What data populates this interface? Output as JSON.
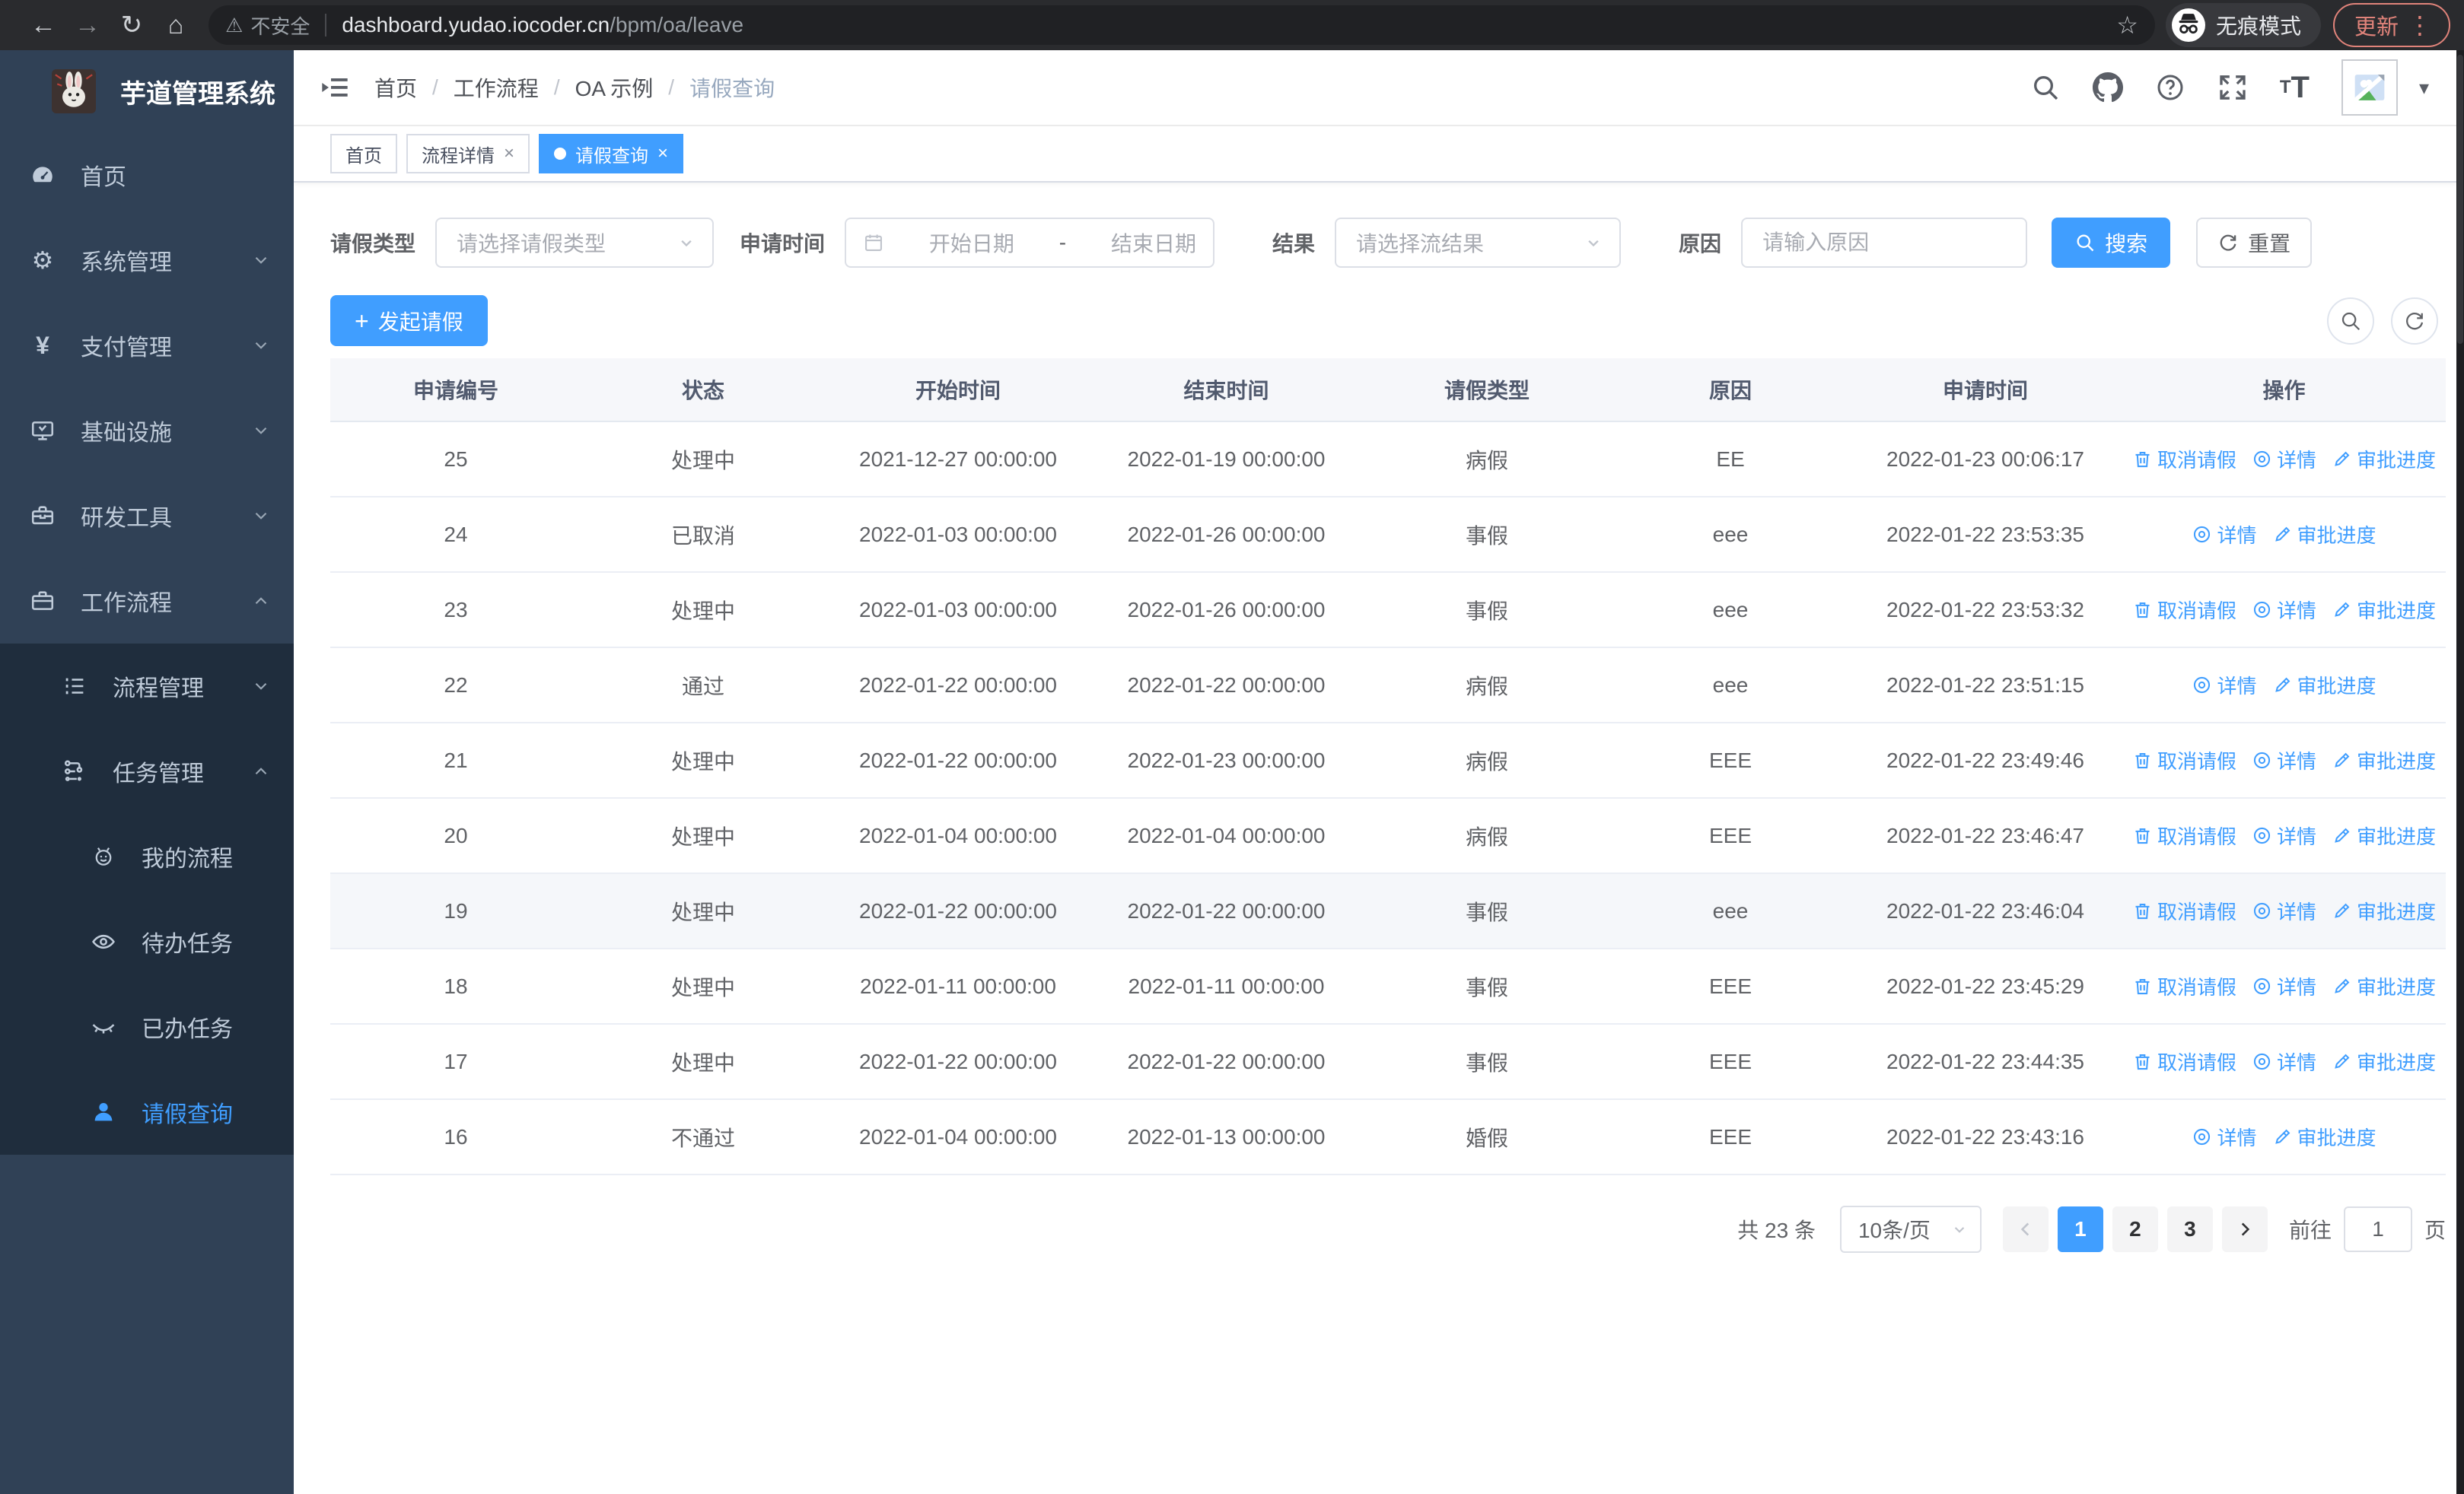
{
  "browser": {
    "security_label": "不安全",
    "url_host": "dashboard.yudao.iocoder.cn",
    "url_path": "/bpm/oa/leave",
    "incognito_label": "无痕模式",
    "update_label": "更新"
  },
  "sidebar": {
    "app_title": "芋道管理系统",
    "menu": [
      {
        "label": "首页"
      },
      {
        "label": "系统管理"
      },
      {
        "label": "支付管理"
      },
      {
        "label": "基础设施"
      },
      {
        "label": "研发工具"
      },
      {
        "label": "工作流程"
      }
    ],
    "submenu": [
      {
        "label": "流程管理"
      },
      {
        "label": "任务管理"
      },
      {
        "label": "我的流程"
      },
      {
        "label": "待办任务"
      },
      {
        "label": "已办任务"
      },
      {
        "label": "请假查询"
      }
    ]
  },
  "navbar": {
    "breadcrumb": [
      "首页",
      "工作流程",
      "OA 示例",
      "请假查询"
    ],
    "breadcrumb_separator": "/"
  },
  "tabs": [
    {
      "label": "首页",
      "closable": false,
      "active": false
    },
    {
      "label": "流程详情",
      "closable": true,
      "active": false
    },
    {
      "label": "请假查询",
      "closable": true,
      "active": true
    }
  ],
  "filters": {
    "leave_type_label": "请假类型",
    "leave_type_placeholder": "请选择请假类型",
    "apply_time_label": "申请时间",
    "date_start_placeholder": "开始日期",
    "date_separator": "-",
    "date_end_placeholder": "结束日期",
    "result_label": "结果",
    "result_placeholder": "请选择流结果",
    "reason_label": "原因",
    "reason_placeholder": "请输入原因",
    "search_label": "搜索",
    "reset_label": "重置"
  },
  "actions_bar": {
    "create_label": "发起请假"
  },
  "table": {
    "columns": [
      "申请编号",
      "状态",
      "开始时间",
      "结束时间",
      "请假类型",
      "原因",
      "申请时间",
      "操作"
    ],
    "action_labels": {
      "cancel": "取消请假",
      "detail": "详情",
      "progress": "审批进度"
    },
    "rows": [
      {
        "id": "25",
        "status": "处理中",
        "start": "2021-12-27 00:00:00",
        "end": "2022-01-19 00:00:00",
        "type": "病假",
        "reason": "EE",
        "applied": "2022-01-23 00:06:17",
        "actions": [
          "cancel",
          "detail",
          "progress"
        ],
        "highlight": false
      },
      {
        "id": "24",
        "status": "已取消",
        "start": "2022-01-03 00:00:00",
        "end": "2022-01-26 00:00:00",
        "type": "事假",
        "reason": "eee",
        "applied": "2022-01-22 23:53:35",
        "actions": [
          "detail",
          "progress"
        ],
        "highlight": false
      },
      {
        "id": "23",
        "status": "处理中",
        "start": "2022-01-03 00:00:00",
        "end": "2022-01-26 00:00:00",
        "type": "事假",
        "reason": "eee",
        "applied": "2022-01-22 23:53:32",
        "actions": [
          "cancel",
          "detail",
          "progress"
        ],
        "highlight": false
      },
      {
        "id": "22",
        "status": "通过",
        "start": "2022-01-22 00:00:00",
        "end": "2022-01-22 00:00:00",
        "type": "病假",
        "reason": "eee",
        "applied": "2022-01-22 23:51:15",
        "actions": [
          "detail",
          "progress"
        ],
        "highlight": false
      },
      {
        "id": "21",
        "status": "处理中",
        "start": "2022-01-22 00:00:00",
        "end": "2022-01-23 00:00:00",
        "type": "病假",
        "reason": "EEE",
        "applied": "2022-01-22 23:49:46",
        "actions": [
          "cancel",
          "detail",
          "progress"
        ],
        "highlight": false
      },
      {
        "id": "20",
        "status": "处理中",
        "start": "2022-01-04 00:00:00",
        "end": "2022-01-04 00:00:00",
        "type": "病假",
        "reason": "EEE",
        "applied": "2022-01-22 23:46:47",
        "actions": [
          "cancel",
          "detail",
          "progress"
        ],
        "highlight": false
      },
      {
        "id": "19",
        "status": "处理中",
        "start": "2022-01-22 00:00:00",
        "end": "2022-01-22 00:00:00",
        "type": "事假",
        "reason": "eee",
        "applied": "2022-01-22 23:46:04",
        "actions": [
          "cancel",
          "detail",
          "progress"
        ],
        "highlight": true
      },
      {
        "id": "18",
        "status": "处理中",
        "start": "2022-01-11 00:00:00",
        "end": "2022-01-11 00:00:00",
        "type": "事假",
        "reason": "EEE",
        "applied": "2022-01-22 23:45:29",
        "actions": [
          "cancel",
          "detail",
          "progress"
        ],
        "highlight": false
      },
      {
        "id": "17",
        "status": "处理中",
        "start": "2022-01-22 00:00:00",
        "end": "2022-01-22 00:00:00",
        "type": "事假",
        "reason": "EEE",
        "applied": "2022-01-22 23:44:35",
        "actions": [
          "cancel",
          "detail",
          "progress"
        ],
        "highlight": false
      },
      {
        "id": "16",
        "status": "不通过",
        "start": "2022-01-04 00:00:00",
        "end": "2022-01-13 00:00:00",
        "type": "婚假",
        "reason": "EEE",
        "applied": "2022-01-22 23:43:16",
        "actions": [
          "detail",
          "progress"
        ],
        "highlight": false
      }
    ]
  },
  "pagination": {
    "total_label": "共 23 条",
    "page_size": "10条/页",
    "pages": [
      "1",
      "2",
      "3"
    ],
    "active_page": "1",
    "goto_label": "前往",
    "goto_value": "1",
    "unit_label": "页"
  },
  "colors": {
    "accent": "#409eff"
  }
}
